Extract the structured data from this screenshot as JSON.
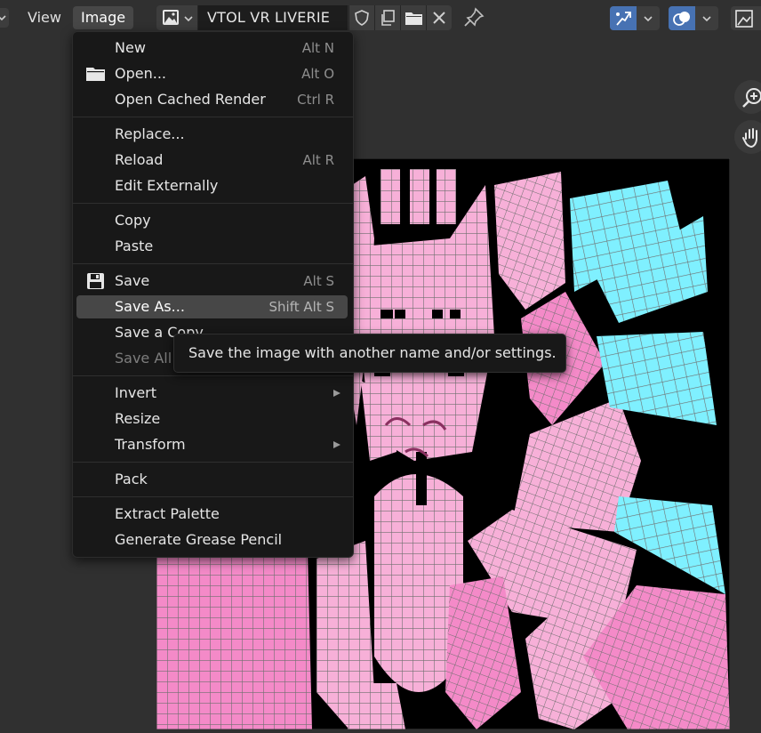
{
  "header": {
    "menus": [
      "View",
      "Image"
    ],
    "image_name": "VTOL VR LIVERIE",
    "icons": [
      "image-type-icon",
      "fake-user-shield-icon",
      "duplicate-icon",
      "open-folder-icon",
      "unlink-x-icon",
      "pin-icon",
      "uv-sync-icon",
      "overlay-icon",
      "display-channels-icon"
    ]
  },
  "menu": {
    "items": [
      {
        "label": "New",
        "shortcut": "Alt N",
        "group": 1
      },
      {
        "label": "Open...",
        "shortcut": "Alt O",
        "icon": "folder-icon",
        "group": 1
      },
      {
        "label": "Open Cached Render",
        "shortcut": "Ctrl R",
        "group": 1
      },
      {
        "label": "Replace...",
        "shortcut": "",
        "group": 2
      },
      {
        "label": "Reload",
        "shortcut": "Alt R",
        "group": 2
      },
      {
        "label": "Edit Externally",
        "shortcut": "",
        "group": 2
      },
      {
        "label": "Copy",
        "shortcut": "",
        "group": 3
      },
      {
        "label": "Paste",
        "shortcut": "",
        "group": 3
      },
      {
        "label": "Save",
        "shortcut": "Alt S",
        "icon": "save-disk-icon",
        "group": 4
      },
      {
        "label": "Save As...",
        "shortcut": "Shift Alt S",
        "group": 4,
        "state": "hover"
      },
      {
        "label": "Save a Copy",
        "shortcut": "",
        "group": 4
      },
      {
        "label": "Save All",
        "shortcut": "",
        "group": 4,
        "state": "disabled"
      },
      {
        "label": "Invert",
        "shortcut": "",
        "group": 5,
        "submenu": true
      },
      {
        "label": "Resize",
        "shortcut": "",
        "group": 5
      },
      {
        "label": "Transform",
        "shortcut": "",
        "group": 5,
        "submenu": true
      },
      {
        "label": "Pack",
        "shortcut": "",
        "group": 6
      },
      {
        "label": "Extract Palette",
        "shortcut": "",
        "group": 7
      },
      {
        "label": "Generate Grease Pencil",
        "shortcut": "",
        "group": 7
      }
    ]
  },
  "tooltip": {
    "text": "Save the image with another name and/or settings."
  },
  "colors": {
    "accent": "#4772b3",
    "uv_pink": "#f7b0d8",
    "uv_pink_dark": "#f07bbf",
    "uv_cyan": "#7ff0ff",
    "wire": "#777777"
  }
}
